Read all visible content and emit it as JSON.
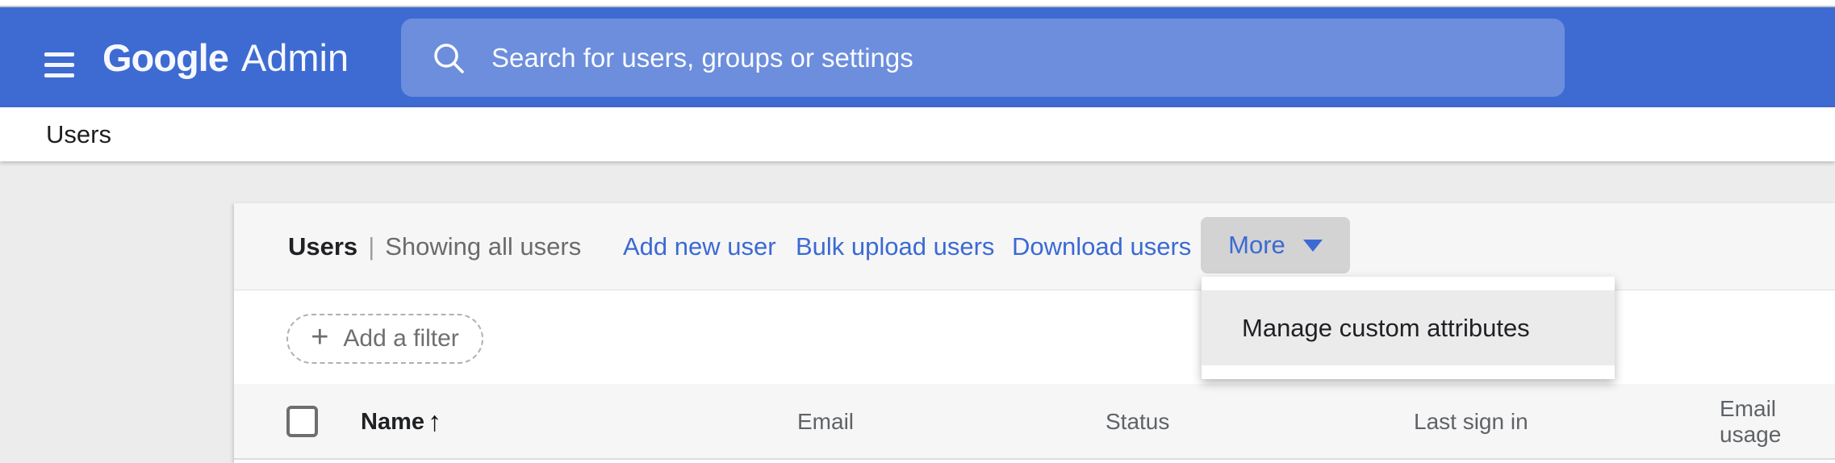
{
  "appbar": {
    "logo_primary": "Google",
    "logo_secondary": "Admin",
    "search": {
      "placeholder": "Search for users, groups or settings",
      "value": ""
    }
  },
  "breadcrumb": {
    "label": "Users"
  },
  "toolbar": {
    "title": "Users",
    "separator": "|",
    "subtitle": "Showing all users",
    "actions": [
      {
        "label": "Add new user"
      },
      {
        "label": "Bulk upload users"
      },
      {
        "label": "Download users"
      }
    ],
    "more": {
      "label": "More",
      "expanded": true
    }
  },
  "more_menu": {
    "items": [
      {
        "label": "Manage custom attributes",
        "highlighted": true
      }
    ]
  },
  "filters": {
    "add_filter": {
      "glyph": "+",
      "label": "Add a filter"
    }
  },
  "users_table": {
    "select_all_checked": false,
    "sort_arrow": "↑",
    "columns": [
      {
        "label": "Name",
        "sorted": "ascending"
      },
      {
        "label": "Email"
      },
      {
        "label": "Status"
      },
      {
        "label": "Last sign in"
      },
      {
        "label": "Email usage"
      }
    ]
  },
  "colors": {
    "appbar_blue": "#3e6bd2",
    "search_field_blue": "#6e90dd",
    "link_blue": "#3b6ad3",
    "page_background": "#ececec",
    "row_background": "#f6f6f6",
    "more_button_background": "#d3d3d3",
    "menu_highlight": "#ebebeb"
  }
}
